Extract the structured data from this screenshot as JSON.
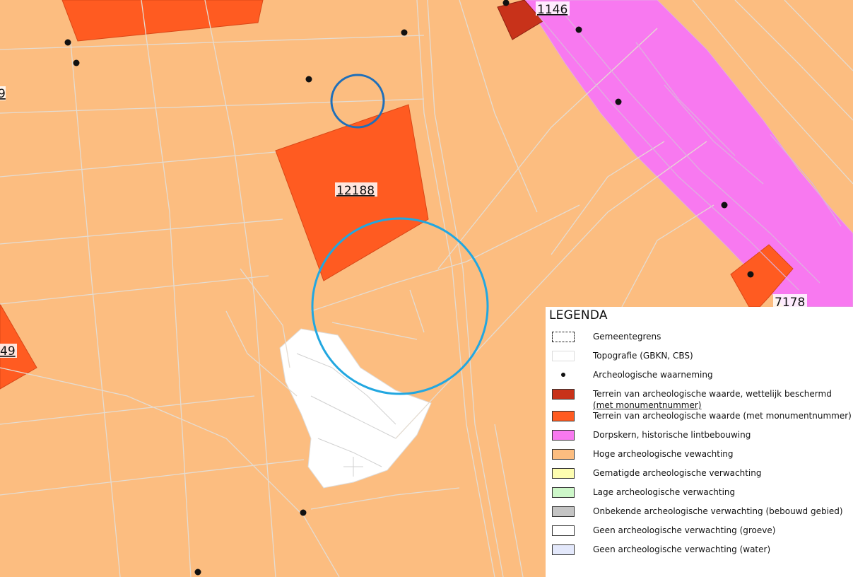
{
  "map": {
    "labels": {
      "l12188": "12188",
      "l1146": "1146",
      "l7178": "7178",
      "l49": "49",
      "l9": "9"
    }
  },
  "legend": {
    "title": "LEGENDA",
    "items": [
      {
        "label": "Gemeentegrens",
        "swatch": "dashed"
      },
      {
        "label": "Topografie (GBKN, CBS)",
        "swatch": "topo"
      },
      {
        "label": "Archeologische waarneming",
        "swatch": "dot"
      },
      {
        "label": "Terrein van archeologische waarde, wettelijk beschermd",
        "sublabel": "(met monumentnummer)",
        "color": "#c8321a"
      },
      {
        "label": "Terrein van archeologische waarde  (met monumentnummer)",
        "color": "#ff5b21"
      },
      {
        "label": "Dorpskern, historische lintbebouwing",
        "color": "#f879f0"
      },
      {
        "label": "Hoge archeologische vewachting",
        "color": "#fcbd80"
      },
      {
        "label": "Gematigde archeologische verwachting",
        "color": "#fdfdb0"
      },
      {
        "label": "Lage archeologische verwachting",
        "color": "#cdf7c9"
      },
      {
        "label": "Onbekende archeologische verwachting (bebouwd gebied)",
        "color": "#c4c4c4"
      },
      {
        "label": "Geen archeologische verwachting (groeve)",
        "color": "#ffffff"
      },
      {
        "label": "Geen archeologische verwachting (water)",
        "color": "#e3e8fb"
      }
    ]
  }
}
